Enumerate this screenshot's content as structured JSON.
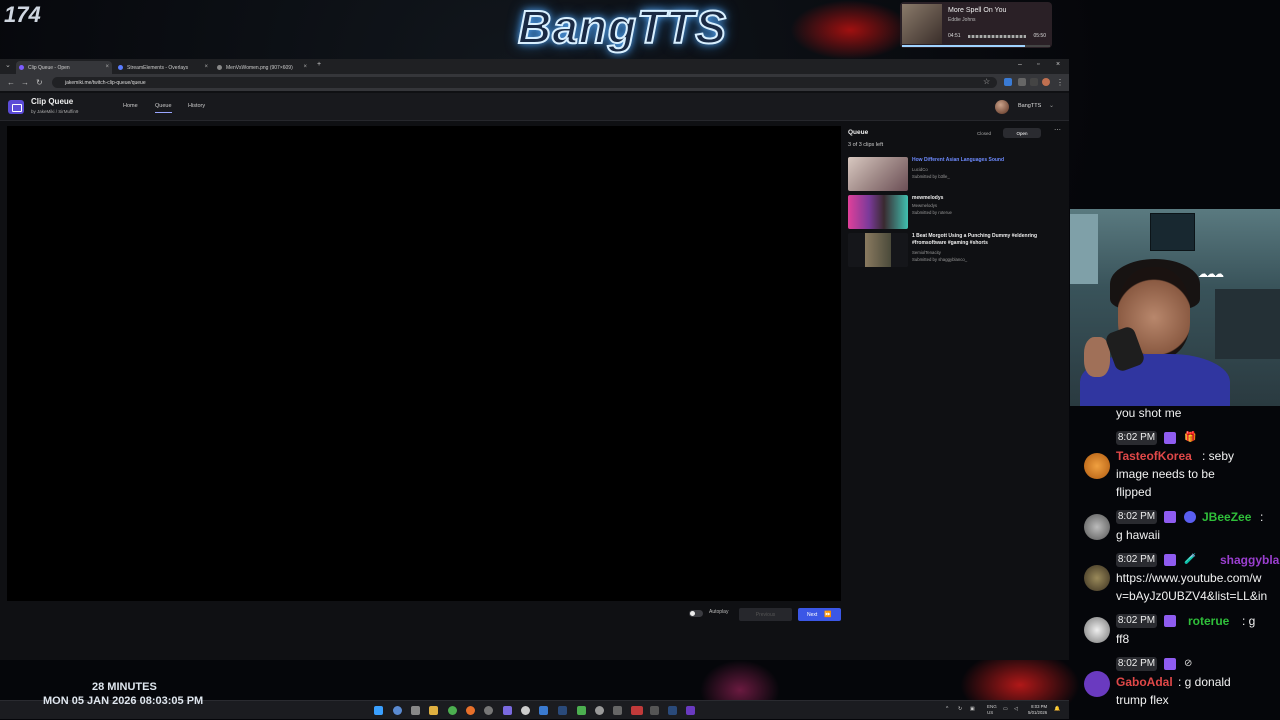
{
  "overlay": {
    "viewer_count": "174",
    "logo_text": "BangTTS",
    "uptime": "28 MINUTES",
    "datetime": "MON 05 JAN 2026 08:03:05 PM",
    "now_playing": {
      "title": "More Spell On You",
      "artist": "Eddie Johns",
      "elapsed": "04:51",
      "duration": "05:50",
      "progress": 0.83
    }
  },
  "browser": {
    "tabs": [
      {
        "label": "Clip Queue - Open",
        "active": true,
        "color": "#7c5cff"
      },
      {
        "label": "StreamElements - Overlays",
        "active": false,
        "color": "#5a7cff"
      },
      {
        "label": "MenVsWomen.png (907×609)",
        "active": false,
        "color": "#888888"
      }
    ],
    "url": "jakemiki.me/twitch-clip-queue/queue"
  },
  "app": {
    "title": "Clip Queue",
    "by_line": "by JakeMiki / SirMuffin9",
    "nav": [
      "Home",
      "Queue",
      "History"
    ],
    "active_nav": "Queue",
    "user": "BangTTS"
  },
  "queue": {
    "title": "Queue",
    "count_text": "3 of 3 clips left",
    "closed_label": "Closed",
    "open_label": "Open",
    "more_icon": "ellipsis-icon",
    "clips": [
      {
        "title": "How Different Asian Languages Sound",
        "channel": "LucidCo",
        "submitted": "Submitted by b3lle_",
        "highlight": true
      },
      {
        "title": "mewmelodys",
        "channel": "Mewmelodys",
        "submitted": "Submitted by roterue",
        "highlight": false
      },
      {
        "title": "1 Beat Morgott Using a Punching Dummy #eldenring #fromsoftware #gaming #shorts",
        "channel": "SemiolTenacity",
        "submitted": "Submitted by shaggyblanco_",
        "highlight": false
      }
    ]
  },
  "player_controls": {
    "autoplay_label": "Autoplay",
    "previous_label": "Previous",
    "next_label": "Next"
  },
  "taskbar": {
    "lang": "ENG",
    "region": "US",
    "time": "8:03 PM",
    "date": "5/01/2026"
  },
  "chat": {
    "messages": [
      {
        "time": "",
        "user": "",
        "user_color": "",
        "text_lines": [
          "you shot me"
        ]
      },
      {
        "time": "8:02 PM",
        "user": "TasteofKorea",
        "user_color": "#e04848",
        "text_lines": [
          "image needs to be",
          "flipped"
        ],
        "inline_text": ": seby"
      },
      {
        "time": "8:02 PM",
        "user": "JBeeZee",
        "user_color": "#2fbf3a",
        "text_lines": [
          "g hawaii"
        ],
        "inline_text": ":"
      },
      {
        "time": "8:02 PM",
        "user": "shaggybla",
        "user_color": "#9b3fd0",
        "text_lines": [
          "https://www.youtube.com/w",
          "v=bAyJz0UBZV4&list=LL&in"
        ],
        "inline_text": ""
      },
      {
        "time": "8:02 PM",
        "user": "roterue",
        "user_color": "#2fbf3a",
        "text_lines": [
          "ff8"
        ],
        "inline_text": ": g"
      },
      {
        "time": "8:02 PM",
        "user": "GaboAdal",
        "user_color": "#e04848",
        "text_lines": [
          "trump flex"
        ],
        "inline_text": ": g donald"
      }
    ]
  }
}
